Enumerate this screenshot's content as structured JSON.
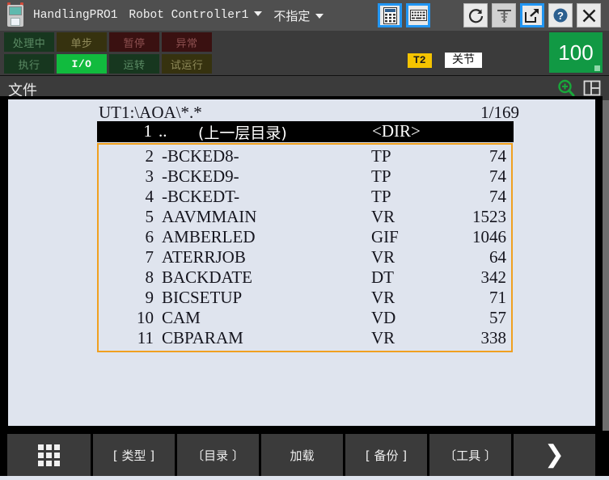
{
  "titlebar": {
    "app_name": "HandlingPRO1",
    "controller": "Robot Controller1",
    "mode": "不指定",
    "icons": [
      "pendant-panel-icon",
      "keyboard-icon",
      "refresh-icon",
      "robot-axes-icon",
      "jump-icon",
      "help-icon",
      "close-icon"
    ]
  },
  "status": {
    "cells": [
      {
        "label": "处理中",
        "state": "off-green"
      },
      {
        "label": "单步",
        "state": "off-olive"
      },
      {
        "label": "暂停",
        "state": "off-red"
      },
      {
        "label": "异常",
        "state": "off-red"
      },
      {
        "label": "执行",
        "state": "off-green"
      },
      {
        "label": "I/O",
        "state": "on-green"
      },
      {
        "label": "运转",
        "state": "off-green"
      },
      {
        "label": "试运行",
        "state": "off-olive"
      }
    ],
    "teach_mode": "T2",
    "coord_mode": "关节",
    "speed": "100"
  },
  "menubar": {
    "label": "文件",
    "zoom_icon": "zoom-in-icon",
    "layout_icon": "window-layout-icon"
  },
  "filelist": {
    "path": "UT1:\\AOA\\*.*",
    "counter": "1/169",
    "parent_row": {
      "num": "1",
      "name": "..",
      "desc": "(上一层目录)",
      "type": "<DIR>"
    },
    "rows": [
      {
        "num": "2",
        "name": "-BCKED8-",
        "type": "TP",
        "size": "74"
      },
      {
        "num": "3",
        "name": "-BCKED9-",
        "type": "TP",
        "size": "74"
      },
      {
        "num": "4",
        "name": "-BCKEDT-",
        "type": "TP",
        "size": "74"
      },
      {
        "num": "5",
        "name": "AAVMMAIN",
        "type": "VR",
        "size": "1523"
      },
      {
        "num": "6",
        "name": "AMBERLED",
        "type": "GIF",
        "size": "1046"
      },
      {
        "num": "7",
        "name": "ATERRJOB",
        "type": "VR",
        "size": "64"
      },
      {
        "num": "8",
        "name": "BACKDATE",
        "type": "DT",
        "size": "342"
      },
      {
        "num": "9",
        "name": "BICSETUP",
        "type": "VR",
        "size": "71"
      },
      {
        "num": "10",
        "name": "CAM",
        "type": "VD",
        "size": "57"
      },
      {
        "num": "11",
        "name": "CBPARAM",
        "type": "VR",
        "size": "338"
      }
    ]
  },
  "toolbar": {
    "menu_icon": "app-grid-icon",
    "buttons": [
      "[ 类型 ]",
      "〔目录 〕",
      "加载",
      "[ 备份 ]",
      "〔工具 〕"
    ],
    "next_icon": "chevron-right-icon"
  },
  "colors": {
    "accent_orange": "#f0a020",
    "speed_green": "#119944",
    "io_green": "#11bb3e",
    "teach_yellow": "#f5c400",
    "select_blue": "#2196f3",
    "content_bg": "#dfe4ee"
  }
}
